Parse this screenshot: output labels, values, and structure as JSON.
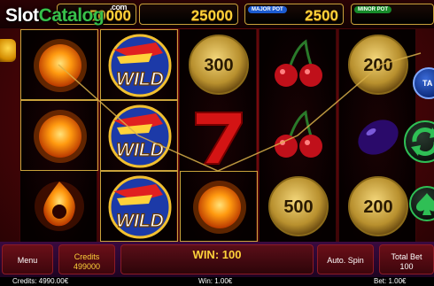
{
  "watermark": {
    "part1": "Slot",
    "part2": "Catalog",
    "domain": ".com"
  },
  "jackpots": [
    {
      "tag": "",
      "amount": "50000"
    },
    {
      "tag": "",
      "amount": "25000"
    },
    {
      "tag": "MAJOR POT",
      "amount": "2500"
    },
    {
      "tag": "MINOR POT",
      "amount": ""
    }
  ],
  "reels": [
    [
      "fire-orb",
      "fire-orb",
      "fire-ring"
    ],
    [
      "wild",
      "wild",
      "wild"
    ],
    [
      "coin-300",
      "seven",
      "fire-orb"
    ],
    [
      "cherries",
      "cherries",
      "coin-500"
    ],
    [
      "coin-200",
      "plum",
      "coin-200"
    ]
  ],
  "coin_values": {
    "coin-300": "300",
    "coin-500": "500",
    "coin-200": "200"
  },
  "wild_text": "WILD",
  "side": {
    "tab_label": "TA"
  },
  "panel": {
    "menu_label": "Menu",
    "credits_label": "Credits",
    "credits_value": "499000",
    "win_text": "WIN: 100",
    "autospin_label": "Auto. Spin",
    "totalbet_label": "Total Bet",
    "totalbet_value": "100"
  },
  "status": {
    "credits": "Credits: 4990.00€",
    "win": "Win: 1.00€",
    "bet": "Bet: 1.00€"
  },
  "colors": {
    "gold": "#ffd23a",
    "panel": "#3a0a40",
    "reel_bg": "#050000",
    "accent_green": "#2fbf55"
  }
}
